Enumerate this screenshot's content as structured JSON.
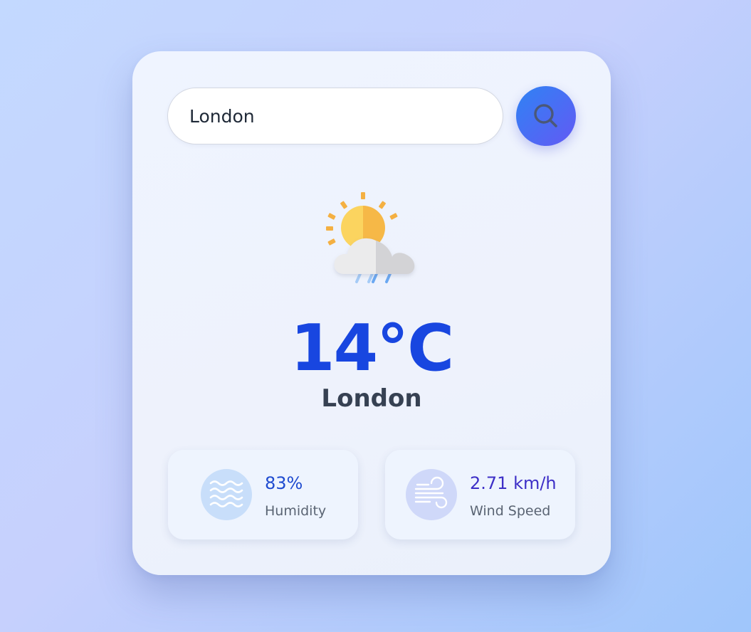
{
  "search": {
    "value": "London",
    "button_icon": "search-icon"
  },
  "weather": {
    "icon": "partly-cloudy-rain-icon",
    "temperature": "14°C",
    "city": "London"
  },
  "stats": {
    "humidity": {
      "icon": "humidity-waves-icon",
      "value": "83%",
      "label": "Humidity"
    },
    "wind": {
      "icon": "wind-icon",
      "value": "2.71 km/h",
      "label": "Wind Speed"
    }
  },
  "colors": {
    "accent": "#1846e0",
    "button_gradient_start": "#2f83f3",
    "button_gradient_end": "#6359f5",
    "city_text": "#364152"
  }
}
